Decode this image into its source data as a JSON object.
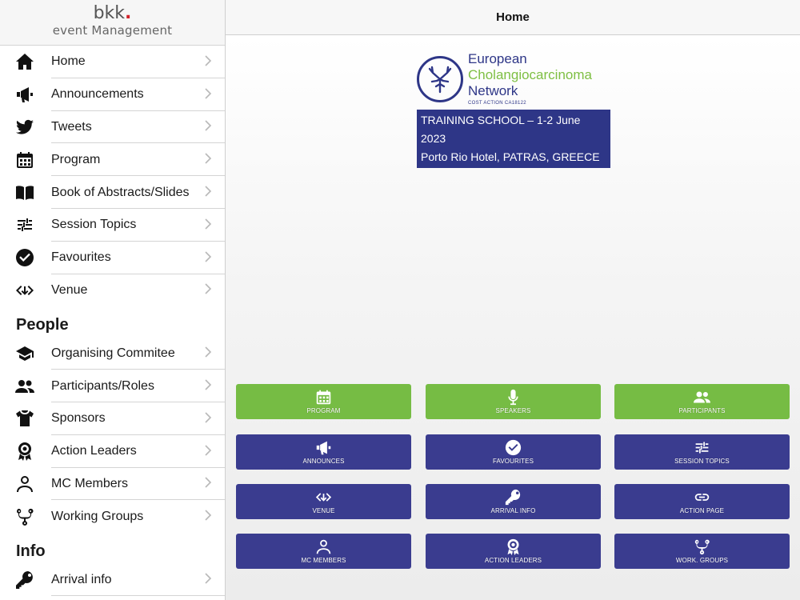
{
  "brand": {
    "name": "bkk",
    "dot": ".",
    "subtitle": "event Management"
  },
  "header": {
    "title": "Home"
  },
  "sidebar": {
    "items": [
      {
        "label": "Home",
        "icon": "home-icon"
      },
      {
        "label": "Announcements",
        "icon": "megaphone-icon"
      },
      {
        "label": "Tweets",
        "icon": "twitter-icon"
      },
      {
        "label": "Program",
        "icon": "calendar-icon"
      },
      {
        "label": "Book of Abstracts/Slides",
        "icon": "book-icon"
      },
      {
        "label": "Session Topics",
        "icon": "sliders-icon"
      },
      {
        "label": "Favourites",
        "icon": "check-circle-icon"
      },
      {
        "label": "Venue",
        "icon": "directions-icon"
      }
    ],
    "people_heading": "People",
    "people": [
      {
        "label": "Organising Commitee",
        "icon": "graduation-cap-icon"
      },
      {
        "label": "Participants/Roles",
        "icon": "people-icon"
      },
      {
        "label": "Sponsors",
        "icon": "tshirt-icon"
      },
      {
        "label": "Action Leaders",
        "icon": "award-icon"
      },
      {
        "label": "MC Members",
        "icon": "person-outline-icon"
      },
      {
        "label": "Working Groups",
        "icon": "fork-icon"
      }
    ],
    "info_heading": "Info",
    "info": [
      {
        "label": "Arrival info",
        "icon": "key-icon"
      }
    ]
  },
  "logo": {
    "line1": "European",
    "line2": "Cholangiocarcinoma",
    "line3": "Network",
    "line4": "COST ACTION CA18122",
    "banner1": "TRAINING SCHOOL – 1-2 June 2023",
    "banner2": "Porto Rio Hotel, PATRAS, GREECE"
  },
  "tiles": [
    {
      "label": "PROGRAM",
      "icon": "calendar-icon",
      "color": "#76bc44"
    },
    {
      "label": "SPEAKERS",
      "icon": "microphone-icon",
      "color": "#76bc44"
    },
    {
      "label": "PARTICIPANTS",
      "icon": "people-icon",
      "color": "#76bc44"
    },
    {
      "label": "ANNOUNCES",
      "icon": "megaphone-icon",
      "color": "#3a3c8f"
    },
    {
      "label": "FAVOURITES",
      "icon": "check-circle-icon",
      "color": "#3a3c8f"
    },
    {
      "label": "SESSION TOPICS",
      "icon": "sliders-icon",
      "color": "#3a3c8f"
    },
    {
      "label": "VENUE",
      "icon": "directions-icon",
      "color": "#3a3c8f"
    },
    {
      "label": "ARRIVAL INFO",
      "icon": "key-icon",
      "color": "#3a3c8f"
    },
    {
      "label": "ACTION PAGE",
      "icon": "link-icon",
      "color": "#3a3c8f"
    },
    {
      "label": "MC MEMBERS",
      "icon": "person-outline-icon",
      "color": "#3a3c8f"
    },
    {
      "label": "ACTION LEADERS",
      "icon": "award-icon",
      "color": "#3a3c8f"
    },
    {
      "label": "WORK. GROUPS",
      "icon": "fork-icon",
      "color": "#3a3c8f"
    }
  ]
}
